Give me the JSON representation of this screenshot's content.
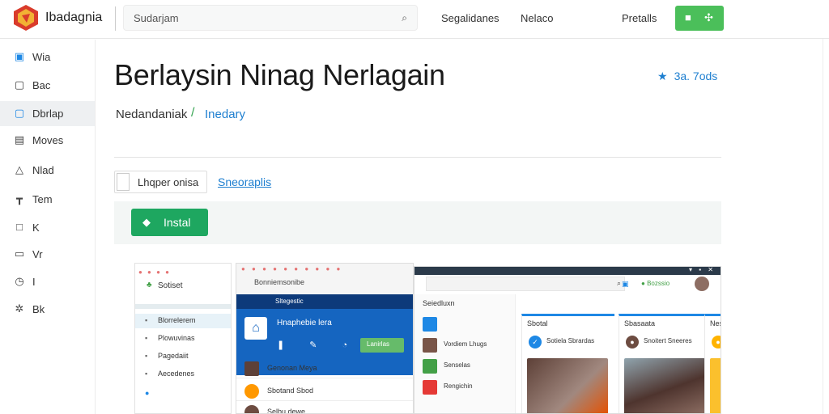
{
  "header": {
    "brand": "Ibadagnia",
    "search_placeholder": "Sudarjam",
    "search_icon": "search-icon",
    "nav": [
      "Segalidanes",
      "Nelaco",
      "Pretalls"
    ],
    "accent": "#4bbf5a"
  },
  "sidebar": {
    "items": [
      {
        "label": "Wia",
        "icon": "image-icon"
      },
      {
        "label": "Bac",
        "icon": "square-icon"
      },
      {
        "label": "Dbrlap",
        "icon": "window-icon",
        "active": true
      },
      {
        "label": "Moves",
        "icon": "film-icon"
      },
      {
        "label": "Nlad",
        "icon": "pyramid-icon"
      },
      {
        "label": "Tem",
        "icon": "tree-icon"
      },
      {
        "label": "K",
        "icon": "box-icon"
      },
      {
        "label": "Vr",
        "icon": "doc-icon"
      },
      {
        "label": "I",
        "icon": "clock-icon"
      },
      {
        "label": "Bk",
        "icon": "gear-icon"
      }
    ]
  },
  "app": {
    "title": "Berlaysin Ninag Nerlagain",
    "developer": "Nedandaniak",
    "separator": "/",
    "category": "Inedary",
    "rating": "3a. 7ods",
    "wishlist_label": "Lhqper onisa",
    "screenshots_link": "Sneoraplis",
    "install_label": "Instal",
    "install_color": "#1ea760"
  },
  "screenshots": {
    "s1": {
      "app_name": "Sotiset",
      "rows": [
        "Blorrelerem",
        "Plowuvinas",
        "Pagedaiit",
        "Aecedenes"
      ]
    },
    "s2": {
      "address": "Bonniemsonibe",
      "nav_text": "Sltegestic",
      "title": "Hnaphebie lera",
      "button": "Lanirlas",
      "rows": [
        "Genonan Meya",
        "Sbotand Sbod",
        "Selbu dewe"
      ]
    },
    "s3": {
      "status": "Bozssio",
      "list_head": "Seiedluxn",
      "list_rows": [
        "Vordiem Lhugs",
        "Senselas",
        "Rengichin"
      ],
      "card1_head": "Sbotal",
      "card1_sub": "Sotiela Sbrardas",
      "card2_head": "Sbasaata",
      "card2_sub": "Snoitert Sneeres",
      "card3_head": "Nes"
    }
  }
}
